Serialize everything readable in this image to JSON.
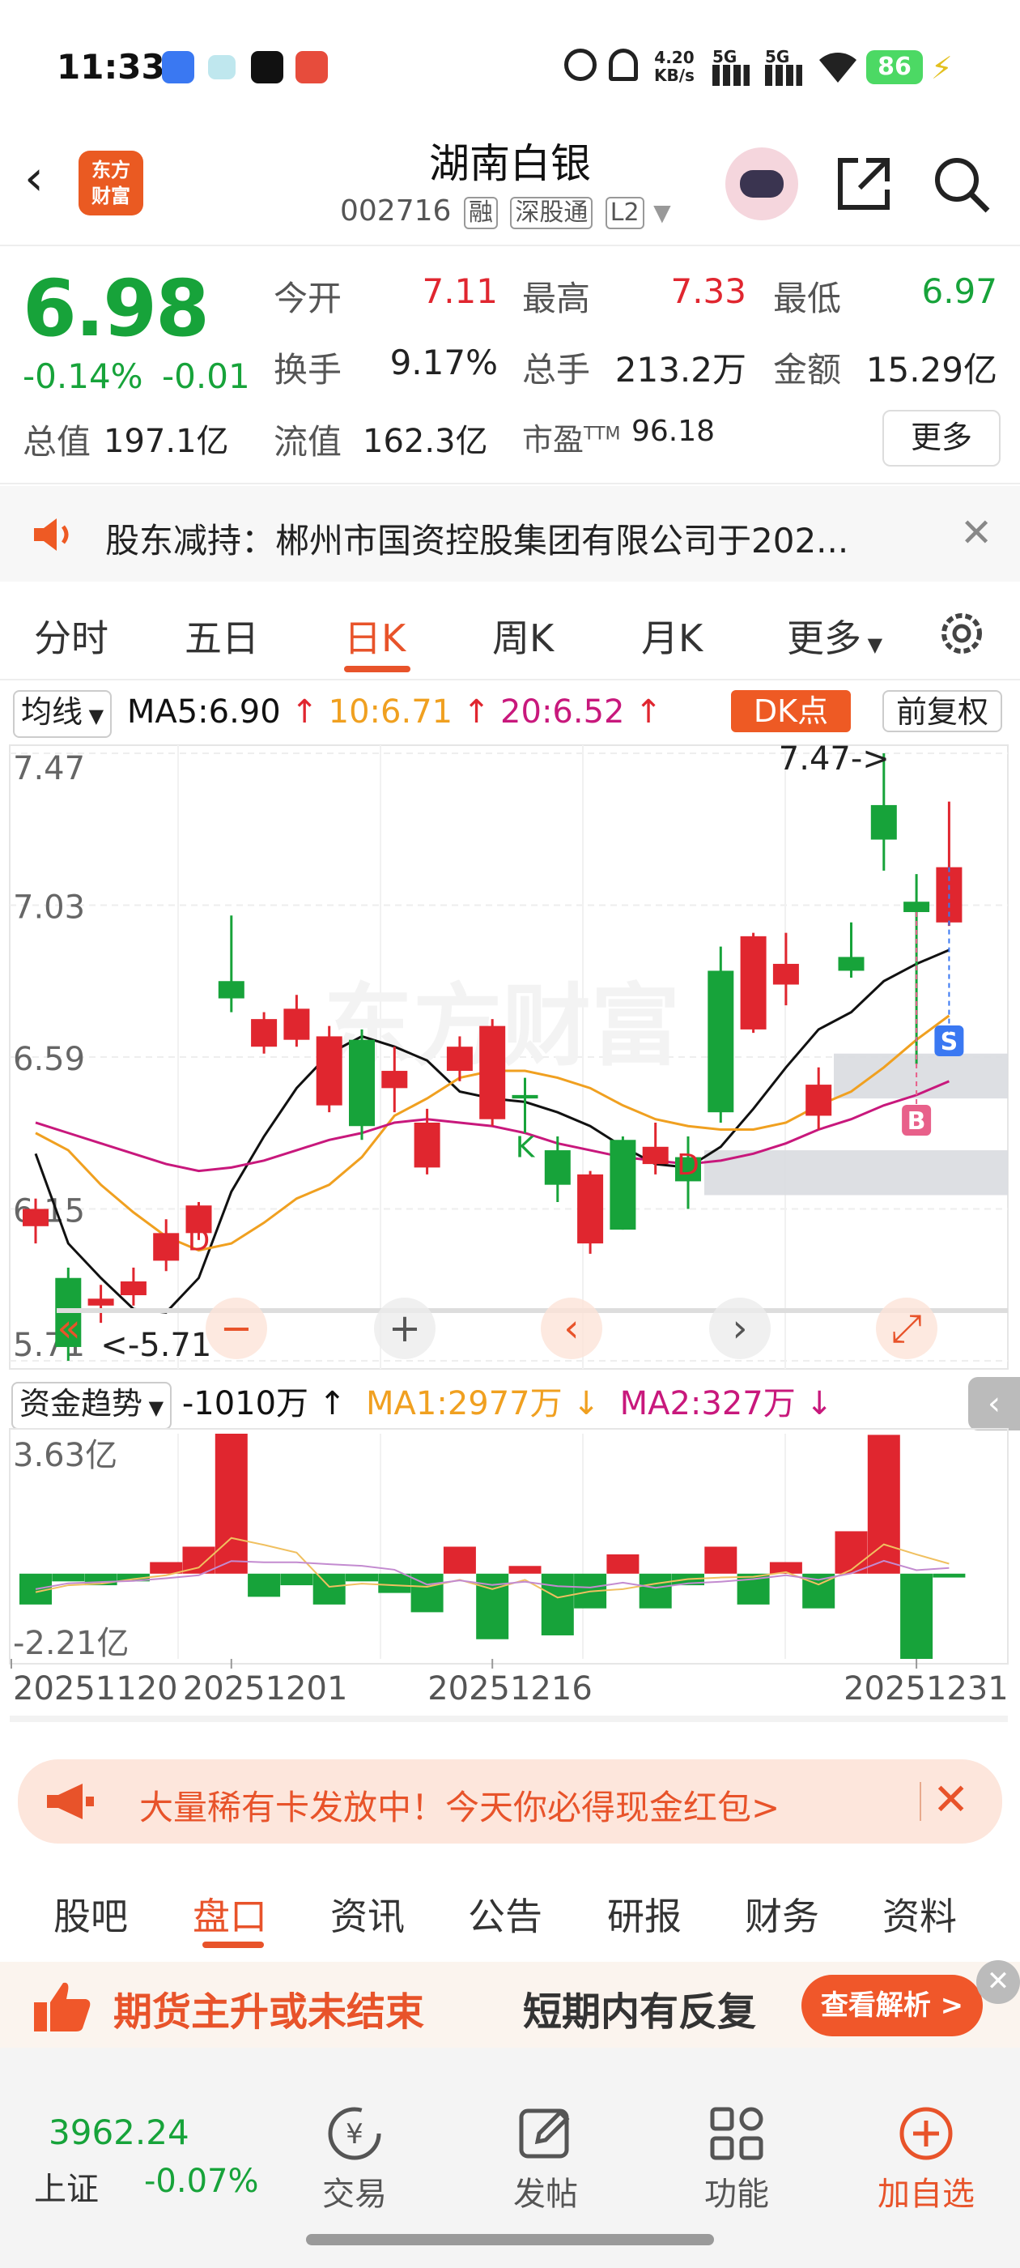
{
  "status_bar": {
    "time": "11:33",
    "net_speed_top": "4.20",
    "net_speed_bottom": "KB/s",
    "signal_1": "5G",
    "signal_2": "5G",
    "battery": "86"
  },
  "header": {
    "logo_line1": "东方",
    "logo_line2": "财富",
    "stock_name": "湖南白银",
    "stock_code": "002716",
    "tags": [
      "融",
      "深股通",
      "L2"
    ]
  },
  "quote": {
    "price": "6.98",
    "change_pct": "-0.14%",
    "change_amt": "-0.01",
    "fields": [
      {
        "label": "今开",
        "value": "7.11",
        "color": "#e0262f"
      },
      {
        "label": "最高",
        "value": "7.33",
        "color": "#e0262f"
      },
      {
        "label": "最低",
        "value": "6.97",
        "color": "#17a33a"
      },
      {
        "label": "换手",
        "value": "9.17%",
        "color": "#222222"
      },
      {
        "label": "总手",
        "value": "213.2万",
        "color": "#222222"
      },
      {
        "label": "金额",
        "value": "15.29亿",
        "color": "#222222"
      },
      {
        "label": "总值",
        "value": "197.1亿",
        "color": "#222222"
      },
      {
        "label": "流值",
        "value": "162.3亿",
        "color": "#222222"
      },
      {
        "label": "市盈",
        "label_sup": "TTM",
        "value": "96.18",
        "color": "#222222"
      }
    ],
    "more_label": "更多"
  },
  "notice": {
    "text": "股东减持：郴州市国资控股集团有限公司于202..."
  },
  "chart_tabs": {
    "tabs": [
      "分时",
      "五日",
      "日K",
      "周K",
      "月K",
      "更多"
    ],
    "active": "日K"
  },
  "ma_row": {
    "selector": "均线",
    "ma5": "MA5:6.90",
    "ma10": "10:6.71",
    "ma20": "20:6.52",
    "dk_label": "DK点",
    "adjust_label": "前复权",
    "colors": {
      "ma5": "#111111",
      "ma10": "#f0a020",
      "ma20": "#c8187c"
    }
  },
  "chart_data": [
    {
      "type": "candlestick",
      "title": "",
      "ylim": [
        5.71,
        7.47
      ],
      "y_ticks": [
        "7.47",
        "7.03",
        "6.59",
        "6.15",
        "5.71"
      ],
      "max_marker": "7.47->",
      "min_marker": "<-5.71",
      "signal_labels": [
        "D",
        "K",
        "D",
        "S",
        "B"
      ],
      "candles": [
        {
          "o": 6.1,
          "h": 6.18,
          "l": 6.05,
          "c": 6.15
        },
        {
          "o": 5.95,
          "h": 5.98,
          "l": 5.71,
          "c": 5.75
        },
        {
          "o": 5.87,
          "h": 5.93,
          "l": 5.82,
          "c": 5.89
        },
        {
          "o": 5.9,
          "h": 5.98,
          "l": 5.87,
          "c": 5.94
        },
        {
          "o": 6.0,
          "h": 6.12,
          "l": 5.97,
          "c": 6.08
        },
        {
          "o": 6.08,
          "h": 6.17,
          "l": 6.06,
          "c": 6.16
        },
        {
          "o": 6.81,
          "h": 7.0,
          "l": 6.72,
          "c": 6.76
        },
        {
          "o": 6.62,
          "h": 6.72,
          "l": 6.6,
          "c": 6.7
        },
        {
          "o": 6.64,
          "h": 6.77,
          "l": 6.62,
          "c": 6.73
        },
        {
          "o": 6.45,
          "h": 6.68,
          "l": 6.43,
          "c": 6.65
        },
        {
          "o": 6.64,
          "h": 6.67,
          "l": 6.35,
          "c": 6.39
        },
        {
          "o": 6.5,
          "h": 6.62,
          "l": 6.43,
          "c": 6.55
        },
        {
          "o": 6.27,
          "h": 6.44,
          "l": 6.25,
          "c": 6.4
        },
        {
          "o": 6.55,
          "h": 6.65,
          "l": 6.52,
          "c": 6.62
        },
        {
          "o": 6.41,
          "h": 6.7,
          "l": 6.39,
          "c": 6.68
        },
        {
          "o": 6.48,
          "h": 6.53,
          "l": 6.37,
          "c": 6.47
        },
        {
          "o": 6.32,
          "h": 6.36,
          "l": 6.17,
          "c": 6.22
        },
        {
          "o": 6.05,
          "h": 6.26,
          "l": 6.02,
          "c": 6.25
        },
        {
          "o": 6.35,
          "h": 6.36,
          "l": 6.09,
          "c": 6.09
        },
        {
          "o": 6.28,
          "h": 6.4,
          "l": 6.25,
          "c": 6.33
        },
        {
          "o": 6.3,
          "h": 6.36,
          "l": 6.15,
          "c": 6.23
        },
        {
          "o": 6.84,
          "h": 6.91,
          "l": 6.4,
          "c": 6.43
        },
        {
          "o": 6.67,
          "h": 6.95,
          "l": 6.66,
          "c": 6.94
        },
        {
          "o": 6.8,
          "h": 6.95,
          "l": 6.74,
          "c": 6.86
        },
        {
          "o": 6.42,
          "h": 6.56,
          "l": 6.38,
          "c": 6.51
        },
        {
          "o": 6.88,
          "h": 6.98,
          "l": 6.82,
          "c": 6.84
        },
        {
          "o": 7.32,
          "h": 7.47,
          "l": 7.13,
          "c": 7.22
        },
        {
          "o": 7.04,
          "h": 7.12,
          "l": 6.57,
          "c": 7.01
        },
        {
          "o": 6.98,
          "h": 7.33,
          "l": 6.97,
          "c": 7.14
        }
      ],
      "ma_lines": {
        "MA5": [
          6.31,
          6.05,
          5.95,
          5.86,
          5.85,
          5.95,
          6.2,
          6.36,
          6.5,
          6.6,
          6.65,
          6.62,
          6.58,
          6.49,
          6.47,
          6.46,
          6.43,
          6.39,
          6.33,
          6.28,
          6.27,
          6.33,
          6.44,
          6.56,
          6.67,
          6.72,
          6.81,
          6.86,
          6.9
        ],
        "MA10": [
          6.37,
          6.32,
          6.22,
          6.14,
          6.07,
          6.03,
          6.05,
          6.11,
          6.18,
          6.22,
          6.3,
          6.42,
          6.47,
          6.53,
          6.55,
          6.55,
          6.53,
          6.5,
          6.45,
          6.41,
          6.39,
          6.38,
          6.38,
          6.4,
          6.45,
          6.49,
          6.56,
          6.64,
          6.71
        ],
        "MA20": [
          6.4,
          6.37,
          6.34,
          6.31,
          6.28,
          6.26,
          6.27,
          6.29,
          6.32,
          6.35,
          6.37,
          6.4,
          6.41,
          6.4,
          6.39,
          6.37,
          6.34,
          6.32,
          6.3,
          6.29,
          6.28,
          6.29,
          6.31,
          6.34,
          6.38,
          6.41,
          6.45,
          6.48,
          6.52
        ]
      }
    },
    {
      "type": "bar",
      "title": "资金趋势",
      "ylim": [
        -2.21,
        3.63
      ],
      "y_ticks": [
        "3.63亿",
        "-2.21亿"
      ],
      "x_ticks": [
        "20251120",
        "20251201",
        "20251216",
        "20251231"
      ],
      "values": [
        -0.8,
        -0.2,
        -0.3,
        -0.2,
        0.3,
        0.7,
        3.63,
        -0.6,
        -0.3,
        -0.8,
        -0.2,
        -0.5,
        -1.0,
        0.7,
        -1.7,
        0.2,
        -1.6,
        -0.9,
        0.5,
        -0.9,
        -0.3,
        0.7,
        -0.8,
        0.3,
        -0.9,
        1.1,
        3.6,
        -2.21,
        -0.1
      ]
    }
  ],
  "fund_row": {
    "selector": "资金趋势",
    "value": "-1010万 ↑",
    "ma1": "MA1:2977万 ↓",
    "ma2": "MA2:327万 ↓"
  },
  "banner": {
    "text": "大量稀有卡发放中！今天你必得现金红包>"
  },
  "bottom_tabs": {
    "tabs": [
      "股吧",
      "盘口",
      "资讯",
      "公告",
      "研报",
      "财务",
      "资料"
    ],
    "active": "盘口"
  },
  "ad": {
    "text1": "期货主升或未结束",
    "text2": "短期内有反复",
    "button": "查看解析 >"
  },
  "footer": {
    "index_value": "3962.24",
    "index_name": "上证",
    "index_change": "-0.07%",
    "items": [
      "交易",
      "发帖",
      "功能",
      "加自选"
    ]
  }
}
